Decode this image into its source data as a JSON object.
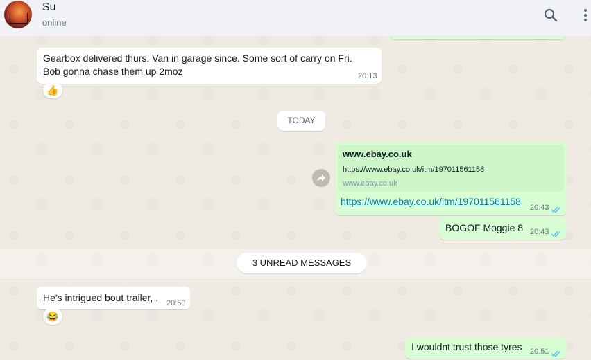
{
  "header": {
    "contact_name": "Su",
    "contact_status": "online",
    "search_icon": "search-icon",
    "menu_icon": "more-vertical-icon"
  },
  "messages": [
    {
      "direction": "incoming",
      "lines": [
        "Gearbox delivered thurs. Van in garage since. Some sort of carry on Fri.",
        "Bob gonna chase them up 2moz"
      ],
      "time": "20:13",
      "reaction": "👍"
    },
    {
      "direction": "outgoing",
      "preview": {
        "title": "www.ebay.co.uk",
        "url": "https://www.ebay.co.uk/itm/197011561158",
        "domain": "www.ebay.co.uk"
      },
      "link": "https://www.ebay.co.uk/itm/197011561158",
      "time": "20:43",
      "status": "read"
    },
    {
      "direction": "outgoing",
      "text": "BOGOF Moggie 8",
      "time": "20:43",
      "status": "read"
    },
    {
      "direction": "incoming",
      "text": "He's intrigued bout trailer, ,",
      "time": "20:50",
      "reaction": "😂"
    },
    {
      "direction": "outgoing",
      "text": "I wouldnt trust those tyres",
      "time": "20:51",
      "status": "read"
    }
  ],
  "dividers": {
    "today": "TODAY",
    "unread": "3 UNREAD MESSAGES"
  },
  "colors": {
    "incoming_bubble": "#ffffff",
    "outgoing_bubble": "#d9fdd3",
    "read_ticks": "#53bdeb",
    "link": "#027eb5",
    "chat_background": "#efeae2"
  }
}
